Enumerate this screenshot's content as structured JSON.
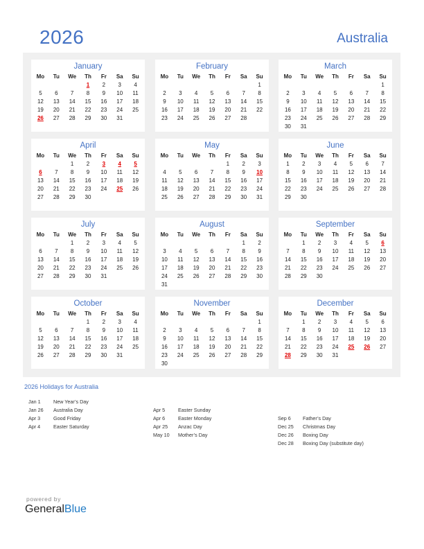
{
  "header": {
    "year": "2026",
    "country": "Australia"
  },
  "weekday_labels": [
    "Mo",
    "Tu",
    "We",
    "Th",
    "Fr",
    "Sa",
    "Su"
  ],
  "colors": {
    "accent": "#4472c4",
    "holiday": "#e00000",
    "panel_bg": "#f0f0f0",
    "brand_blue": "#1f7ac4"
  },
  "months": [
    {
      "name": "January",
      "offset": 3,
      "days": 31,
      "holidays": [
        1,
        26
      ]
    },
    {
      "name": "February",
      "offset": 6,
      "days": 28,
      "holidays": []
    },
    {
      "name": "March",
      "offset": 6,
      "days": 31,
      "holidays": []
    },
    {
      "name": "April",
      "offset": 2,
      "days": 30,
      "holidays": [
        3,
        4,
        5,
        6,
        25
      ]
    },
    {
      "name": "May",
      "offset": 4,
      "days": 31,
      "holidays": [
        10
      ]
    },
    {
      "name": "June",
      "offset": 0,
      "days": 30,
      "holidays": []
    },
    {
      "name": "July",
      "offset": 2,
      "days": 31,
      "holidays": []
    },
    {
      "name": "August",
      "offset": 5,
      "days": 31,
      "holidays": []
    },
    {
      "name": "September",
      "offset": 1,
      "days": 30,
      "holidays": [
        6
      ]
    },
    {
      "name": "October",
      "offset": 3,
      "days": 31,
      "holidays": []
    },
    {
      "name": "November",
      "offset": 6,
      "days": 30,
      "holidays": []
    },
    {
      "name": "December",
      "offset": 1,
      "days": 31,
      "holidays": [
        25,
        26,
        28
      ]
    }
  ],
  "holidays_section": {
    "title": "2026 Holidays for Australia",
    "columns": [
      [
        {
          "date": "Jan 1",
          "name": "New Year’s Day"
        },
        {
          "date": "Jan 26",
          "name": "Australia Day"
        },
        {
          "date": "Apr 3",
          "name": "Good Friday"
        },
        {
          "date": "Apr 4",
          "name": "Easter Saturday"
        }
      ],
      [
        {
          "date": "Apr 5",
          "name": "Easter Sunday"
        },
        {
          "date": "Apr 6",
          "name": "Easter Monday"
        },
        {
          "date": "Apr 25",
          "name": "Anzac Day"
        },
        {
          "date": "May 10",
          "name": "Mother’s Day"
        }
      ],
      [
        {
          "date": "Sep 6",
          "name": "Father’s Day"
        },
        {
          "date": "Dec 25",
          "name": "Christmas Day"
        },
        {
          "date": "Dec 26",
          "name": "Boxing Day"
        },
        {
          "date": "Dec 28",
          "name": "Boxing Day (substitute day)"
        }
      ]
    ]
  },
  "footer": {
    "powered_by": "powered by",
    "brand_general": "General",
    "brand_blue": "Blue"
  }
}
